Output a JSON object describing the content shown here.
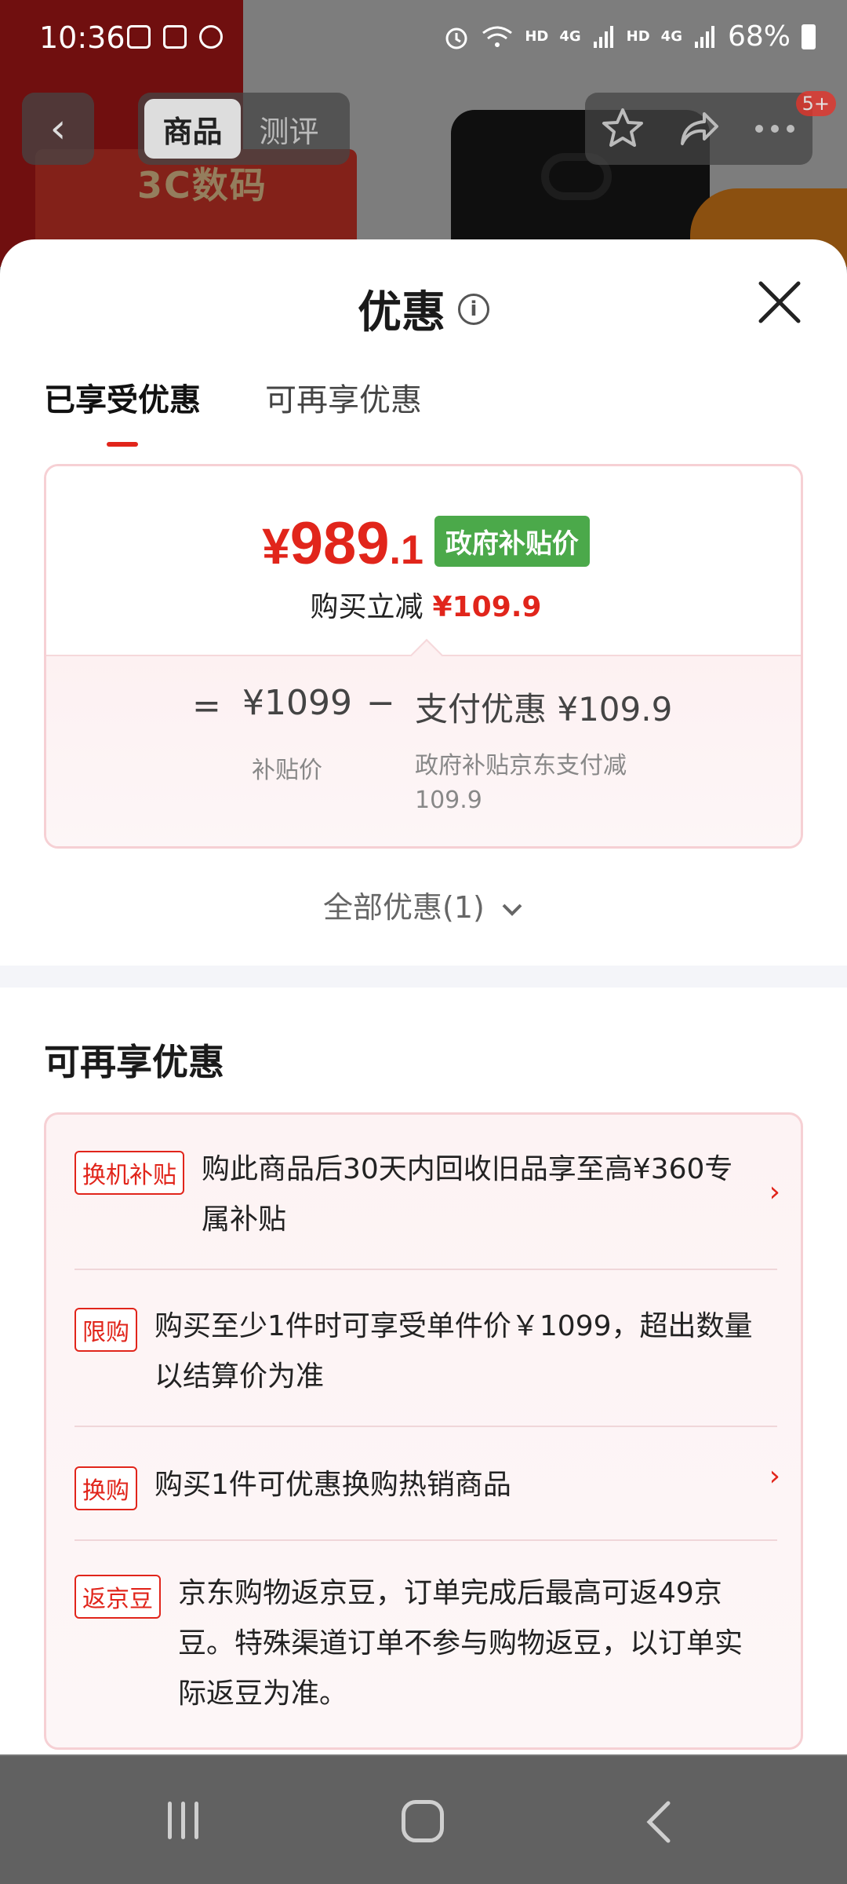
{
  "status_bar": {
    "time": "10:36",
    "net1": "HD",
    "net2": "4G",
    "net3": "HD",
    "net4": "4G",
    "battery": "68%"
  },
  "top_nav": {
    "tabs": [
      "商品",
      "测评"
    ],
    "badge": "5+",
    "banner_text": "3C数码"
  },
  "sheet": {
    "title": "优惠",
    "tabs": [
      "已享受优惠",
      "可再享优惠"
    ],
    "price": {
      "yen": "¥",
      "integer": "989",
      "decimal": ".1",
      "tag": "政府补贴价",
      "saving_label": "购买立减",
      "saving_value": "¥109.9"
    },
    "breakdown": {
      "equals": "=",
      "subsidy_price": "¥1099",
      "subsidy_price_label": "补贴价",
      "minus": "−",
      "pay_discount": "支付优惠 ¥109.9",
      "pay_discount_note": "政府补贴京东支付减109.9"
    },
    "all_discounts": "全部优惠(1)",
    "more_title": "可再享优惠",
    "promos": [
      {
        "tag": "换机补贴",
        "text": "购此商品后30天内回收旧品享至高¥360专属补贴",
        "arrow": "›"
      },
      {
        "tag": "限购",
        "text": "购买至少1件时可享受单件价￥1099，超出数量以结算价为准",
        "arrow": ""
      },
      {
        "tag": "换购",
        "text": "购买1件可优惠换购热销商品",
        "arrow": "›"
      },
      {
        "tag": "返京豆",
        "text": "京东购物返京豆，订单完成后最高可返49京豆。特殊渠道订单不参与购物返豆，以订单实际返豆为准。",
        "arrow": ""
      }
    ]
  },
  "colors": {
    "accent_red": "#e1251b",
    "gov_green": "#4ba94a",
    "nav_bar": "#616161"
  }
}
